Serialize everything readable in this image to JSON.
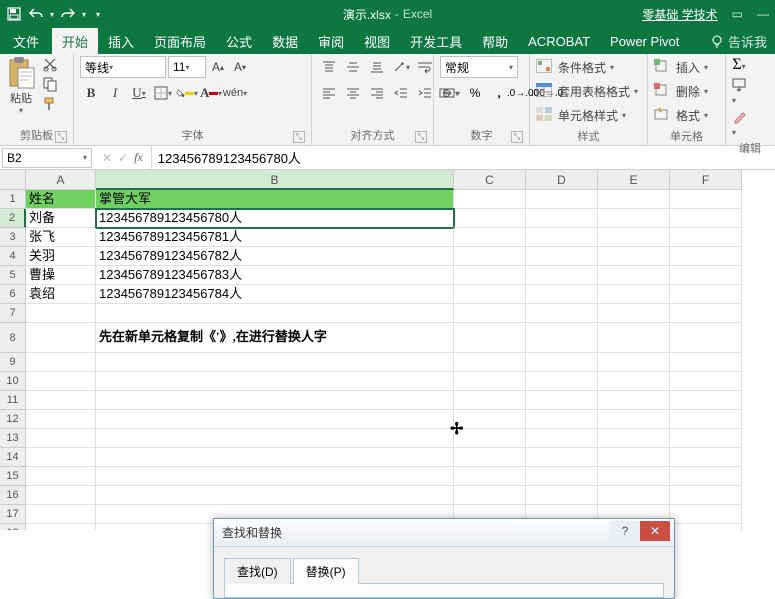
{
  "title": {
    "filename": "演示.xlsx",
    "sep": "-",
    "app": "Excel",
    "link": "零基础 学技术"
  },
  "tabs": {
    "file": "文件",
    "items": [
      "开始",
      "插入",
      "页面布局",
      "公式",
      "数据",
      "审阅",
      "视图",
      "开发工具",
      "帮助",
      "ACROBAT",
      "Power Pivot"
    ],
    "active_index": 0,
    "tellme": "告诉我"
  },
  "ribbon": {
    "clipboard": {
      "paste": "粘贴",
      "label": "剪贴板"
    },
    "font": {
      "name": "等线",
      "size": "11",
      "label": "字体"
    },
    "align": {
      "label": "对齐方式"
    },
    "number": {
      "format": "常规",
      "label": "数字"
    },
    "styles": {
      "cond": "条件格式",
      "table": "套用表格格式",
      "cell": "单元格样式",
      "label": "样式"
    },
    "cells": {
      "insert": "插入",
      "delete": "删除",
      "format": "格式",
      "label": "单元格"
    },
    "editing": {
      "label": "编辑"
    }
  },
  "namebox": "B2",
  "formula": "123456789123456780人",
  "columns": [
    "A",
    "B",
    "C",
    "D",
    "E",
    "F"
  ],
  "rows_shown": 19,
  "active_cell": {
    "row": 2,
    "col": "B"
  },
  "headers": {
    "A": "姓名",
    "B": "掌管大军"
  },
  "data_rows": [
    {
      "a": "刘备",
      "b": "123456789123456780人"
    },
    {
      "a": "张飞",
      "b": "123456789123456781人"
    },
    {
      "a": "关羽",
      "b": "123456789123456782人"
    },
    {
      "a": "曹操",
      "b": "123456789123456783人"
    },
    {
      "a": "袁绍",
      "b": "123456789123456784人"
    }
  ],
  "message_cell": "先在新单元格复制《'》,在进行替换人字",
  "dialog": {
    "title": "查找和替换",
    "tab_find": "查找(D)",
    "tab_replace": "替换(P)",
    "active_tab": 1
  }
}
